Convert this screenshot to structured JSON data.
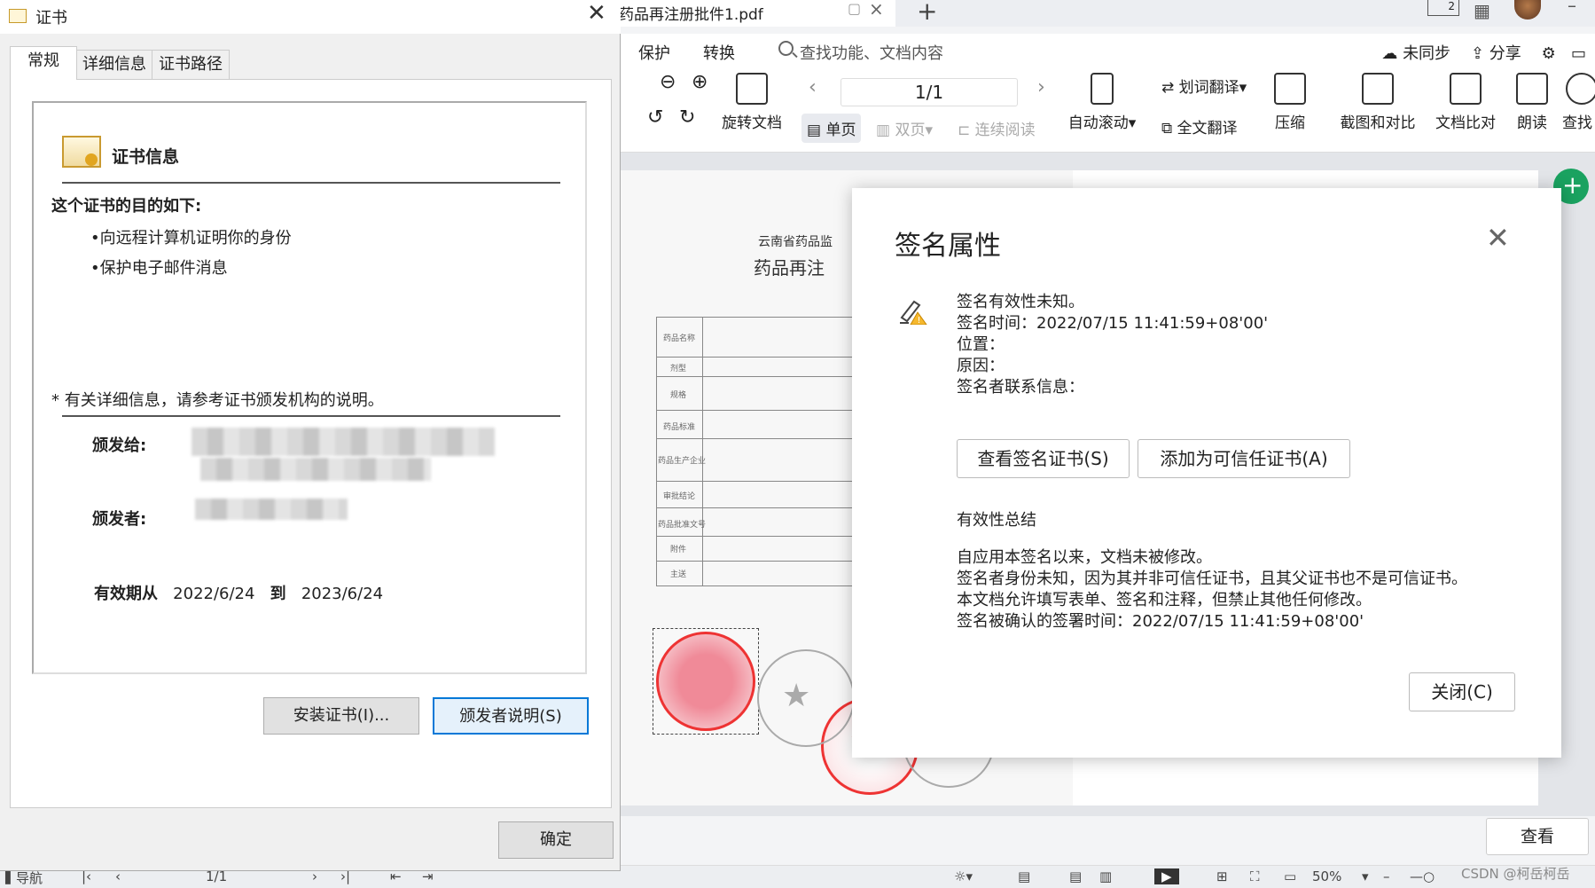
{
  "pdf_app": {
    "tab_title": "药品再注册批件1.pdf",
    "menu": [
      "保护",
      "转换"
    ],
    "search_placeholder": "查找功能、文档内容",
    "sync_label": "未同步",
    "share_label": "分享",
    "toolbar": {
      "rotate_doc": "旋转文档",
      "page_indicator": "1/1",
      "single_page": "单页",
      "double_page": "双页",
      "continuous_read": "连续阅读",
      "auto_scroll": "自动滚动",
      "word_translate": "划词翻译",
      "full_translate": "全文翻译",
      "compress": "压缩",
      "screenshot_compare": "截图和对比",
      "doc_compare": "文档比对",
      "read_aloud": "朗读",
      "find": "查找"
    },
    "view_button": "查看",
    "status": {
      "nav": "导航",
      "page": "1/1",
      "zoom": "50%"
    },
    "watermark": "CSDN @柯岳柯岳"
  },
  "cert_dialog": {
    "title": "证书",
    "tabs": [
      "常规",
      "详细信息",
      "证书路径"
    ],
    "info_title": "证书信息",
    "purpose_heading": "这个证书的目的如下:",
    "purposes": [
      "•向远程计算机证明你的身份",
      "•保护电子邮件消息"
    ],
    "detail_note": "* 有关详细信息，请参考证书颁发机构的说明。",
    "issued_to_label": "颁发给:",
    "issued_by_label": "颁发者:",
    "validity_from_label": "有效期从",
    "validity_from": "2022/6/24",
    "validity_to_label": "到",
    "validity_to": "2023/6/24",
    "install_button": "安装证书(I)...",
    "issuer_statement_button": "颁发者说明(S)",
    "ok_button": "确定"
  },
  "sig_dialog": {
    "title": "签名属性",
    "lines": [
      "签名有效性未知。",
      "签名时间：2022/07/15 11:41:59+08'00'",
      "位置：",
      "原因：",
      "签名者联系信息："
    ],
    "view_cert_button": "查看签名证书(S)",
    "add_trusted_button": "添加为可信任证书(A)",
    "summary_heading": "有效性总结",
    "summary_lines": [
      "自应用本签名以来，文档未被修改。",
      "签名者身份未知，因为其并非可信任证书，且其父证书也不是可信证书。",
      "本文档允许填写表单、签名和注释，但禁止其他任何修改。",
      "签名被确认的签署时间：2022/07/15 11:41:59+08'00'"
    ],
    "close_button": "关闭(C)"
  },
  "pdf_content": {
    "header_1": "云南省药品监",
    "header_2": "药品再注",
    "row_labels": [
      "药品名称",
      "剂型",
      "规格",
      "药品标准",
      "药品生产企业",
      "审批结论",
      "药品批准文号",
      "附件",
      "主送"
    ]
  }
}
